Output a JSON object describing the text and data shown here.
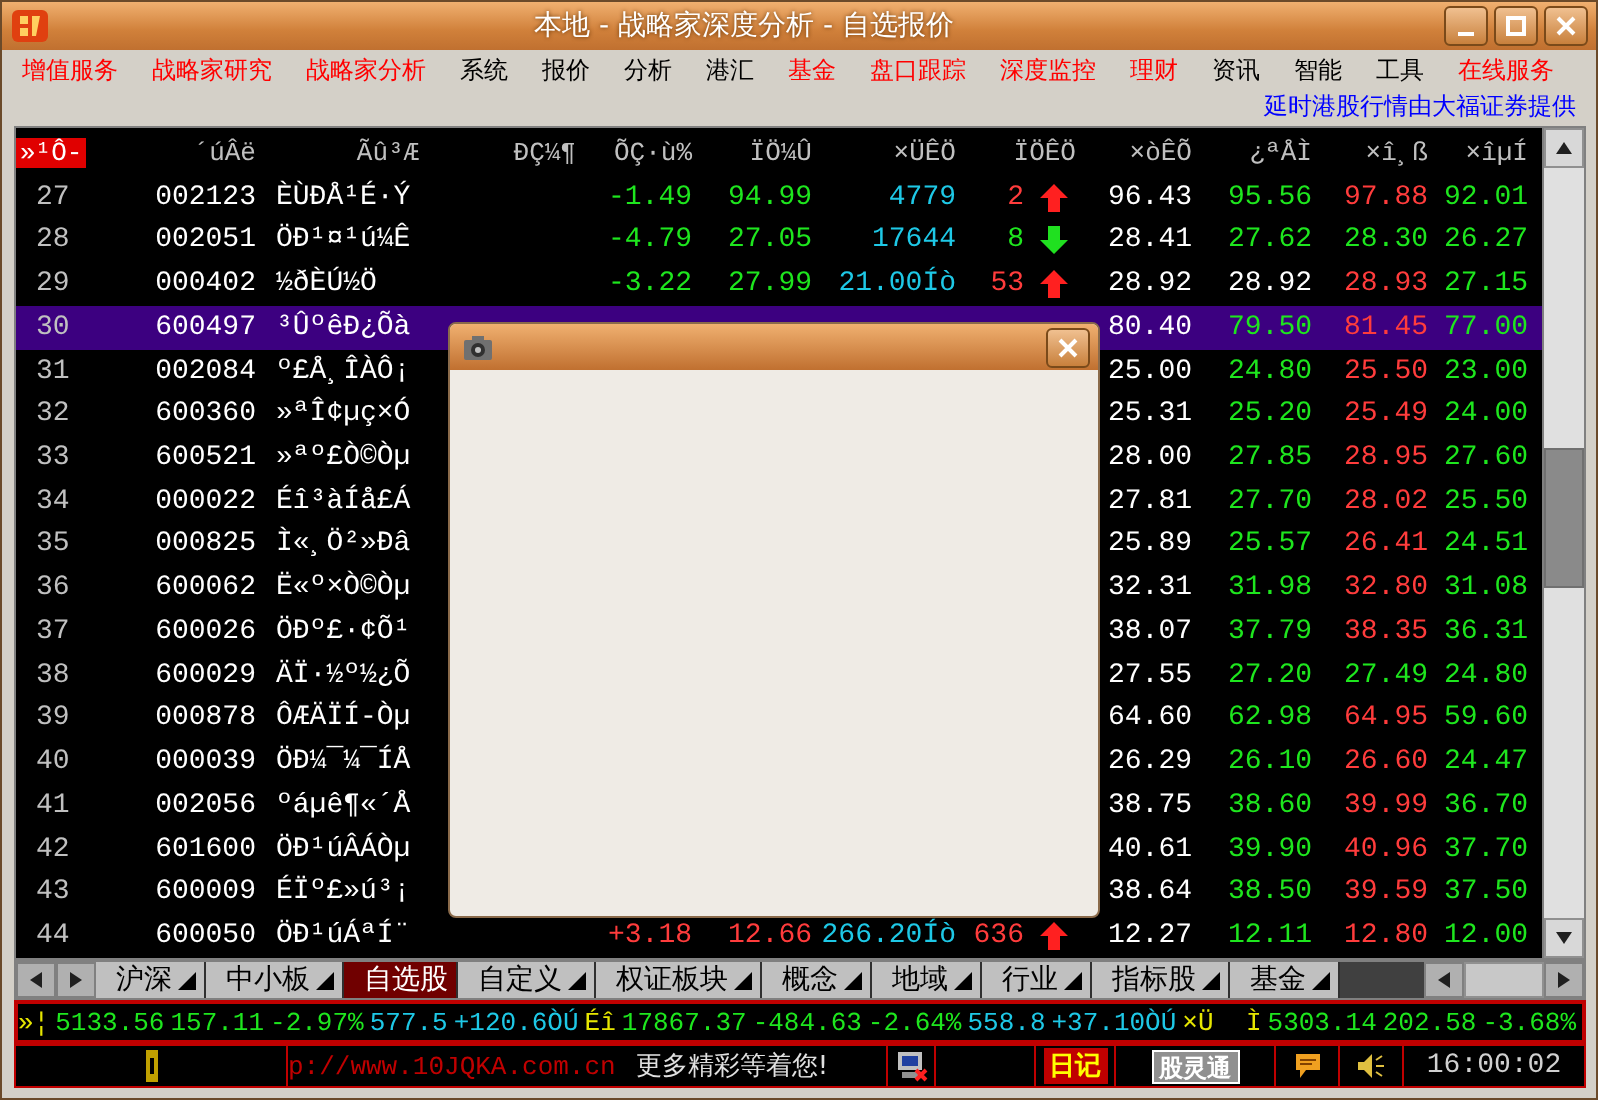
{
  "window": {
    "title": "本地 - 战略家深度分析 - 自选报价"
  },
  "menu": [
    {
      "label": "增值服务",
      "highlight": true
    },
    {
      "label": "战略家研究",
      "highlight": true
    },
    {
      "label": "战略家分析",
      "highlight": true
    },
    {
      "label": "系统",
      "highlight": false
    },
    {
      "label": "报价",
      "highlight": false
    },
    {
      "label": "分析",
      "highlight": false
    },
    {
      "label": "港汇",
      "highlight": false
    },
    {
      "label": "基金",
      "highlight": true
    },
    {
      "label": "盘口跟踪",
      "highlight": true
    },
    {
      "label": "深度监控",
      "highlight": true
    },
    {
      "label": "理财",
      "highlight": true
    },
    {
      "label": "资讯",
      "highlight": false
    },
    {
      "label": "智能",
      "highlight": false
    },
    {
      "label": "工具",
      "highlight": false
    },
    {
      "label": "在线服务",
      "highlight": true
    }
  ],
  "notice": "延时港股行情由大福证券提供",
  "table": {
    "columns": [
      {
        "label": "»¹Ô-",
        "selected": true
      },
      {
        "label": "´úÂë",
        "selected": false
      },
      {
        "label": "Ãû³Æ",
        "selected": false
      },
      {
        "label": "ÐÇ¼¶",
        "selected": false
      },
      {
        "label": "ÕÇ·ù%",
        "selected": false
      },
      {
        "label": "ÏÖ¼Û",
        "selected": false
      },
      {
        "label": "×ÜÊÖ",
        "selected": false
      },
      {
        "label": "ÏÖÊÖ",
        "selected": false
      },
      {
        "label": "×òÊÕ",
        "selected": false
      },
      {
        "label": "¿ªÅÌ",
        "selected": false
      },
      {
        "label": "×î¸ß",
        "selected": false
      },
      {
        "label": "×îµÍ",
        "selected": false
      }
    ],
    "rows": [
      {
        "no": "27",
        "code": "002123",
        "name": "ÈÙÐÅ¹É·Ý",
        "selected": false,
        "change": {
          "text": "-1.49",
          "color": "#1ee61e"
        },
        "price": {
          "text": "94.99",
          "color": "#1ee61e"
        },
        "volume": {
          "text": "4779",
          "color": "#1ec8e6"
        },
        "hand": {
          "text": "2",
          "color": "#ff3c3c"
        },
        "rising": true,
        "prev": {
          "text": "96.43",
          "color": "#ffffff"
        },
        "open": {
          "text": "95.56",
          "color": "#1ee61e"
        },
        "high": {
          "text": "97.88",
          "color": "#ff3c3c"
        },
        "low": {
          "text": "92.01",
          "color": "#1ee61e"
        }
      },
      {
        "no": "28",
        "code": "002051",
        "name": "ÖÐ¹¤¹ú¼Ê",
        "selected": false,
        "change": {
          "text": "-4.79",
          "color": "#1ee61e"
        },
        "price": {
          "text": "27.05",
          "color": "#1ee61e"
        },
        "volume": {
          "text": "17644",
          "color": "#1ec8e6"
        },
        "hand": {
          "text": "8",
          "color": "#1ee61e"
        },
        "rising": false,
        "prev": {
          "text": "28.41",
          "color": "#ffffff"
        },
        "open": {
          "text": "27.62",
          "color": "#1ee61e"
        },
        "high": {
          "text": "28.30",
          "color": "#1ee61e"
        },
        "low": {
          "text": "26.27",
          "color": "#1ee61e"
        }
      },
      {
        "no": "29",
        "code": "000402",
        "name": "½ðÈÚ½Ö",
        "selected": false,
        "change": {
          "text": "-3.22",
          "color": "#1ee61e"
        },
        "price": {
          "text": "27.99",
          "color": "#1ee61e"
        },
        "volume": {
          "text": "21.00Íò",
          "color": "#1ec8e6"
        },
        "hand": {
          "text": "53",
          "color": "#ff3c3c"
        },
        "rising": true,
        "prev": {
          "text": "28.92",
          "color": "#ffffff"
        },
        "open": {
          "text": "28.92",
          "color": "#ffffff"
        },
        "high": {
          "text": "28.93",
          "color": "#ff3c3c"
        },
        "low": {
          "text": "27.15",
          "color": "#1ee61e"
        }
      },
      {
        "no": "30",
        "code": "600497",
        "name": "³ÛºêÐ¿Õà",
        "selected": true,
        "prev": {
          "text": "80.40",
          "color": "#ffffff"
        },
        "open": {
          "text": "79.50",
          "color": "#1ee61e"
        },
        "high": {
          "text": "81.45",
          "color": "#ff3c3c"
        },
        "low": {
          "text": "77.00",
          "color": "#1ee61e"
        }
      },
      {
        "no": "31",
        "code": "002084",
        "name": "º£Å¸ÎÀÔ¡",
        "selected": false,
        "prev": {
          "text": "25.00",
          "color": "#ffffff"
        },
        "open": {
          "text": "24.80",
          "color": "#1ee61e"
        },
        "high": {
          "text": "25.50",
          "color": "#ff3c3c"
        },
        "low": {
          "text": "23.00",
          "color": "#1ee61e"
        }
      },
      {
        "no": "32",
        "code": "600360",
        "name": "»ªÎ¢µç×Ó",
        "selected": false,
        "prev": {
          "text": "25.31",
          "color": "#ffffff"
        },
        "open": {
          "text": "25.20",
          "color": "#1ee61e"
        },
        "high": {
          "text": "25.49",
          "color": "#ff3c3c"
        },
        "low": {
          "text": "24.00",
          "color": "#1ee61e"
        }
      },
      {
        "no": "33",
        "code": "600521",
        "name": "»ªº£Ò©Òµ",
        "selected": false,
        "prev": {
          "text": "28.00",
          "color": "#ffffff"
        },
        "open": {
          "text": "27.85",
          "color": "#1ee61e"
        },
        "high": {
          "text": "28.95",
          "color": "#ff3c3c"
        },
        "low": {
          "text": "27.60",
          "color": "#1ee61e"
        }
      },
      {
        "no": "34",
        "code": "000022",
        "name": "Éî³àÍå£Á",
        "selected": false,
        "prev": {
          "text": "27.81",
          "color": "#ffffff"
        },
        "open": {
          "text": "27.70",
          "color": "#1ee61e"
        },
        "high": {
          "text": "28.02",
          "color": "#ff3c3c"
        },
        "low": {
          "text": "25.50",
          "color": "#1ee61e"
        }
      },
      {
        "no": "35",
        "code": "000825",
        "name": "Ì«¸Ö²»Ðâ",
        "selected": false,
        "prev": {
          "text": "25.89",
          "color": "#ffffff"
        },
        "open": {
          "text": "25.57",
          "color": "#1ee61e"
        },
        "high": {
          "text": "26.41",
          "color": "#ff3c3c"
        },
        "low": {
          "text": "24.51",
          "color": "#1ee61e"
        }
      },
      {
        "no": "36",
        "code": "600062",
        "name": "Ë«º×Ò©Òµ",
        "selected": false,
        "prev": {
          "text": "32.31",
          "color": "#ffffff"
        },
        "open": {
          "text": "31.98",
          "color": "#1ee61e"
        },
        "high": {
          "text": "32.80",
          "color": "#ff3c3c"
        },
        "low": {
          "text": "31.08",
          "color": "#1ee61e"
        }
      },
      {
        "no": "37",
        "code": "600026",
        "name": "ÖÐº£·¢Õ¹",
        "selected": false,
        "prev": {
          "text": "38.07",
          "color": "#ffffff"
        },
        "open": {
          "text": "37.79",
          "color": "#1ee61e"
        },
        "high": {
          "text": "38.35",
          "color": "#ff3c3c"
        },
        "low": {
          "text": "36.31",
          "color": "#1ee61e"
        }
      },
      {
        "no": "38",
        "code": "600029",
        "name": "ÄÏ·½º½¿Õ",
        "selected": false,
        "prev": {
          "text": "27.55",
          "color": "#ffffff"
        },
        "open": {
          "text": "27.20",
          "color": "#1ee61e"
        },
        "high": {
          "text": "27.49",
          "color": "#1ee61e"
        },
        "low": {
          "text": "24.80",
          "color": "#1ee61e"
        }
      },
      {
        "no": "39",
        "code": "000878",
        "name": "ÔÆÄÏÍ-Òµ",
        "selected": false,
        "prev": {
          "text": "64.60",
          "color": "#ffffff"
        },
        "open": {
          "text": "62.98",
          "color": "#1ee61e"
        },
        "high": {
          "text": "64.95",
          "color": "#ff3c3c"
        },
        "low": {
          "text": "59.60",
          "color": "#1ee61e"
        }
      },
      {
        "no": "40",
        "code": "000039",
        "name": "ÖÐ¼¯¼¯ÍÅ",
        "selected": false,
        "prev": {
          "text": "26.29",
          "color": "#ffffff"
        },
        "open": {
          "text": "26.10",
          "color": "#1ee61e"
        },
        "high": {
          "text": "26.60",
          "color": "#ff3c3c"
        },
        "low": {
          "text": "24.47",
          "color": "#1ee61e"
        }
      },
      {
        "no": "41",
        "code": "002056",
        "name": "ºáµê¶«´Å",
        "selected": false,
        "prev": {
          "text": "38.75",
          "color": "#ffffff"
        },
        "open": {
          "text": "38.60",
          "color": "#1ee61e"
        },
        "high": {
          "text": "39.99",
          "color": "#ff3c3c"
        },
        "low": {
          "text": "36.70",
          "color": "#1ee61e"
        }
      },
      {
        "no": "42",
        "code": "601600",
        "name": "ÖÐ¹úÂÁÒµ",
        "selected": false,
        "prev": {
          "text": "40.61",
          "color": "#ffffff"
        },
        "open": {
          "text": "39.90",
          "color": "#1ee61e"
        },
        "high": {
          "text": "40.96",
          "color": "#ff3c3c"
        },
        "low": {
          "text": "37.70",
          "color": "#1ee61e"
        }
      },
      {
        "no": "43",
        "code": "600009",
        "name": "ÉÏº£»ú³¡",
        "selected": false,
        "prev": {
          "text": "38.64",
          "color": "#ffffff"
        },
        "open": {
          "text": "38.50",
          "color": "#1ee61e"
        },
        "high": {
          "text": "39.59",
          "color": "#ff3c3c"
        },
        "low": {
          "text": "37.50",
          "color": "#1ee61e"
        }
      },
      {
        "no": "44",
        "code": "600050",
        "name": "ÖÐ¹úÁªÍ¨",
        "selected": false,
        "change": {
          "text": "+3.18",
          "color": "#ff3c3c"
        },
        "price": {
          "text": "12.66",
          "color": "#ff3c3c"
        },
        "volume": {
          "text": "266.20Íò",
          "color": "#1ec8e6"
        },
        "hand": {
          "text": "636",
          "color": "#ff3c3c"
        },
        "rising": true,
        "prev": {
          "text": "12.27",
          "color": "#ffffff"
        },
        "open": {
          "text": "12.11",
          "color": "#1ee61e"
        },
        "high": {
          "text": "12.80",
          "color": "#ff3c3c"
        },
        "low": {
          "text": "12.00",
          "color": "#1ee61e"
        }
      }
    ]
  },
  "sheet_tabs": [
    {
      "label": "沪深",
      "selected": false,
      "has_menu": true
    },
    {
      "label": "中小板",
      "selected": false,
      "has_menu": true
    },
    {
      "label": "自选股",
      "selected": true,
      "has_menu": false
    },
    {
      "label": "自定义",
      "selected": false,
      "has_menu": true
    },
    {
      "label": "权证板块",
      "selected": false,
      "has_menu": true
    },
    {
      "label": "概念",
      "selected": false,
      "has_menu": true
    },
    {
      "label": "地域",
      "selected": false,
      "has_menu": true
    },
    {
      "label": "行业",
      "selected": false,
      "has_menu": true
    },
    {
      "label": "指标股",
      "selected": false,
      "has_menu": true
    },
    {
      "label": "基金",
      "selected": false,
      "has_menu": true
    }
  ],
  "ticker": {
    "left": [
      {
        "text": "»¦",
        "color": "#e6e600"
      },
      {
        "text": "5133.56",
        "color": "#1ee61e"
      },
      {
        "text": "157.11",
        "color": "#1ee61e"
      },
      {
        "text": "-2.97%",
        "color": "#1ee61e"
      },
      {
        "text": "577.5",
        "color": "#1ec8e6"
      },
      {
        "text": "+120.6ÒÚ",
        "color": "#1ec8e6"
      },
      {
        "text": "Éî",
        "color": "#e6e600"
      },
      {
        "text": "17867.37",
        "color": "#1ee61e"
      },
      {
        "text": "-484.63",
        "color": "#1ee61e"
      },
      {
        "text": "-2.64%",
        "color": "#1ee61e"
      },
      {
        "text": "558.8",
        "color": "#1ec8e6"
      },
      {
        "text": "+37.10ÒÚ",
        "color": "#1ec8e6"
      },
      {
        "text": "×Ü",
        "color": "#e6e600"
      }
    ],
    "right": [
      {
        "text": "Ì",
        "color": "#e6e600"
      },
      {
        "text": "5303.14",
        "color": "#1ee61e"
      },
      {
        "text": "202.58",
        "color": "#1ee61e"
      },
      {
        "text": "-3.68%",
        "color": "#1ee61e"
      }
    ]
  },
  "status_bar": {
    "url": "p://www.10JQKA.com.cn",
    "message": "更多精彩等着您!",
    "diary": "日记",
    "stock_link": "股灵通",
    "time": "16:00:02"
  }
}
